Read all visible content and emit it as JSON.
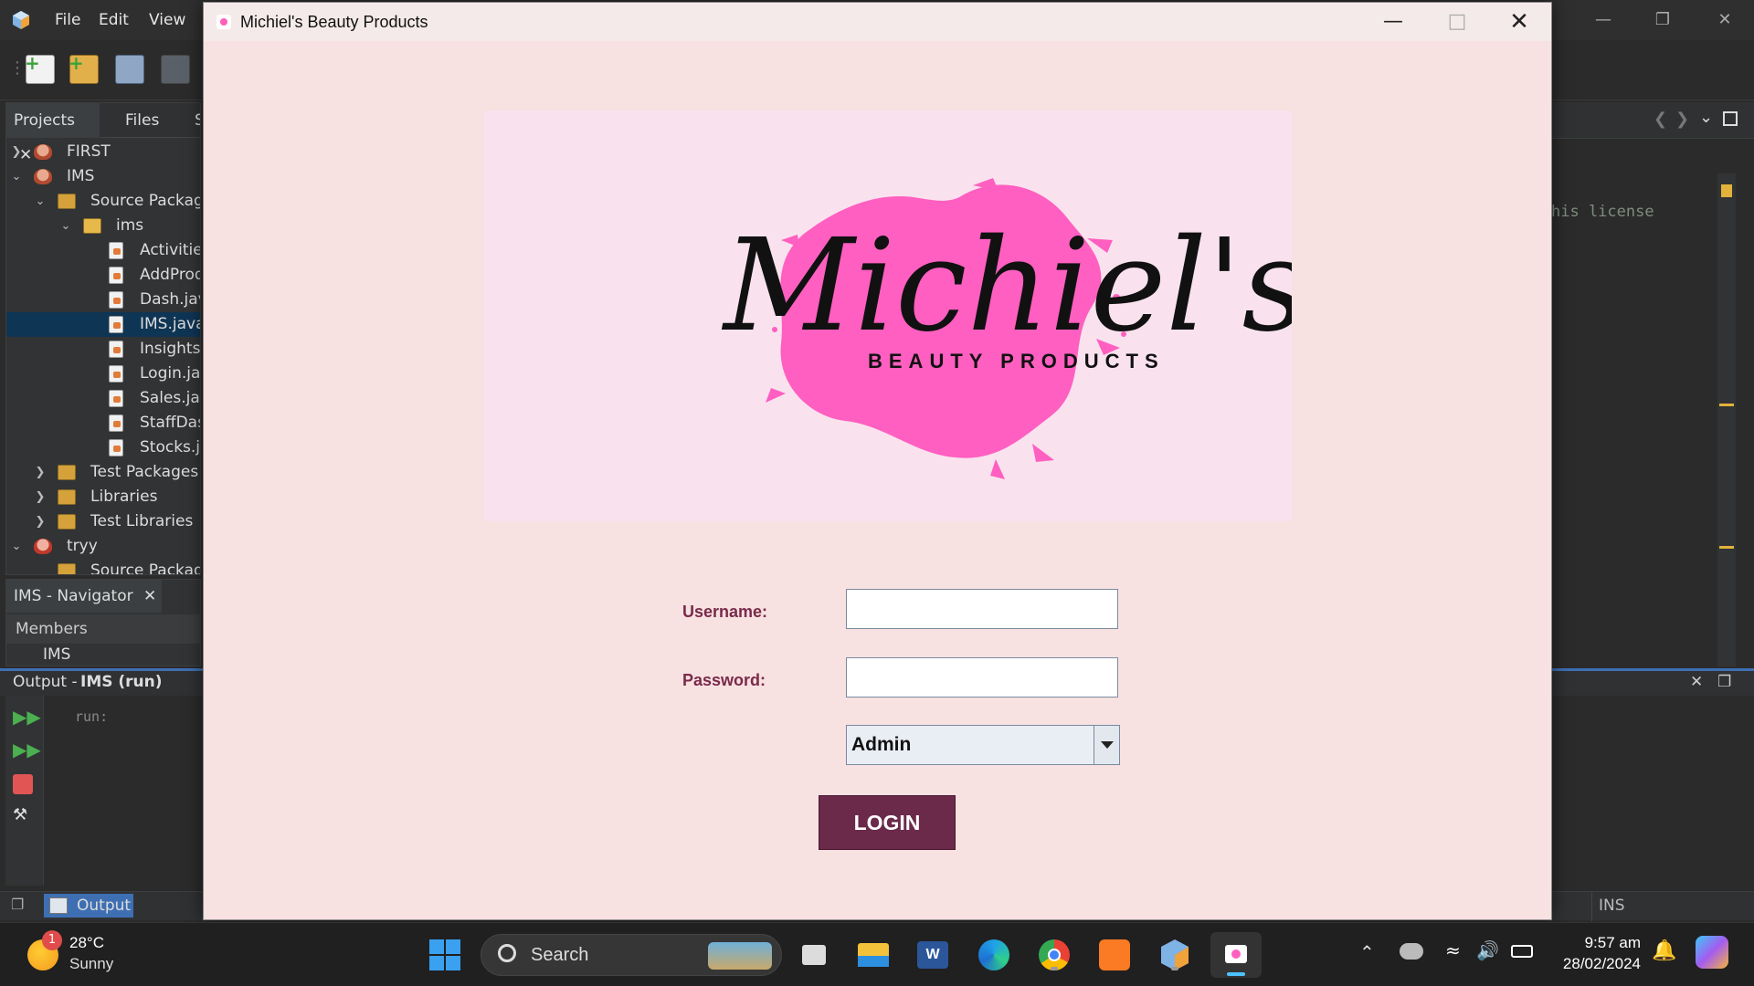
{
  "ide": {
    "menu": [
      "File",
      "Edit",
      "View"
    ],
    "project_tabs": [
      "Projects",
      "Files",
      "S"
    ],
    "tree": [
      {
        "label": "FIRST"
      },
      {
        "label": "IMS"
      },
      {
        "label": "Source Packages"
      },
      {
        "label": "ims"
      },
      {
        "label": "Activities.java"
      },
      {
        "label": "AddProduct.java"
      },
      {
        "label": "Dash.java"
      },
      {
        "label": "IMS.java"
      },
      {
        "label": "Insights.java"
      },
      {
        "label": "Login.java"
      },
      {
        "label": "Sales.java"
      },
      {
        "label": "StaffDash.java"
      },
      {
        "label": "Stocks.java"
      },
      {
        "label": "Test Packages"
      },
      {
        "label": "Libraries"
      },
      {
        "label": "Test Libraries"
      },
      {
        "label": "tryy"
      },
      {
        "label": "Source Packages"
      }
    ],
    "navigator_tab": "IMS - Navigator",
    "members_label": "Members",
    "navigator_item": "IMS",
    "output_title_prefix": "Output - ",
    "output_title_bold": "IMS (run)",
    "output_text": "run:",
    "code_fragment": "his license",
    "status_output_tab": "Output",
    "status_ins": "INS"
  },
  "app": {
    "title": "Michiel's Beauty Products",
    "logo": {
      "script": "Michiel's",
      "tagline": "BEAUTY PRODUCTS"
    },
    "username_label": "Username:",
    "password_label": "Password:",
    "username_value": "",
    "password_value": "",
    "role_selected": "Admin",
    "login_label": "LOGIN",
    "colors": {
      "background": "#f7e1e1",
      "logo_bg": "#f9e2ee",
      "accent": "#6b2a4a",
      "splash": "#ff5fc0",
      "label": "#7a2a4b"
    }
  },
  "taskbar": {
    "weather_temp": "28°C",
    "weather_desc": "Sunny",
    "weather_badge": "1",
    "search_label": "Search",
    "time": "9:57 am",
    "date": "28/02/2024",
    "apps": [
      "start-icon",
      "task-view-icon",
      "file-explorer-icon",
      "word-icon",
      "edge-icon",
      "chrome-icon",
      "xampp-icon",
      "netbeans-icon",
      "java-app-icon"
    ]
  }
}
